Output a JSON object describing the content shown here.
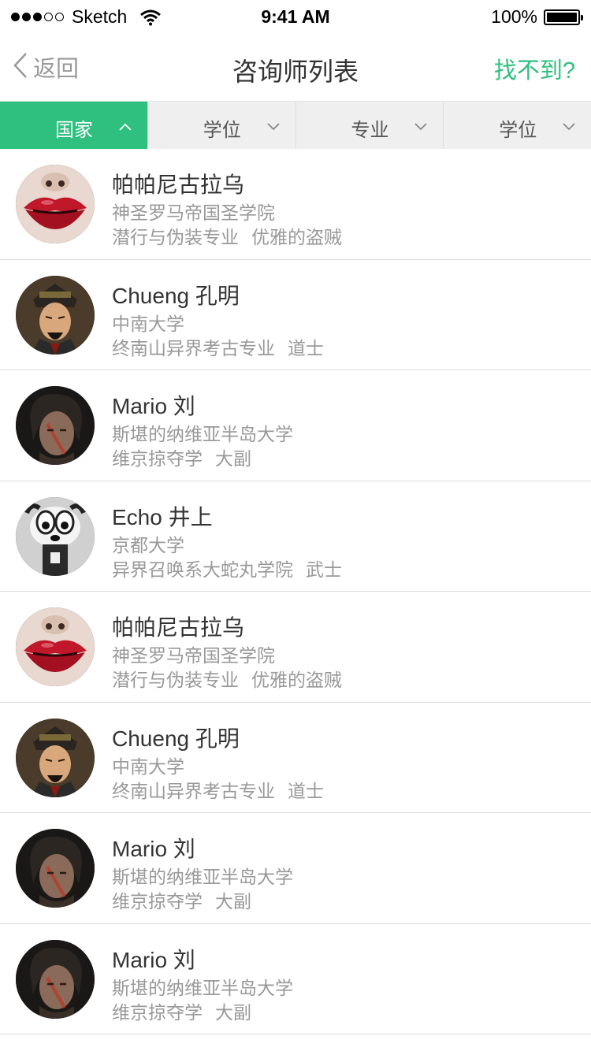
{
  "status_bar": {
    "carrier": "Sketch",
    "time": "9:41 AM",
    "battery": "100%"
  },
  "nav": {
    "back_label": "返回",
    "title": "咨询师列表",
    "action_label": "找不到?"
  },
  "filters": [
    {
      "label": "国家",
      "active": true
    },
    {
      "label": "学位",
      "active": false
    },
    {
      "label": "专业",
      "active": false
    },
    {
      "label": "学位",
      "active": false
    }
  ],
  "advisors": [
    {
      "name": "帕帕尼古拉乌",
      "school": "神圣罗马帝国圣学院",
      "major": "潜行与伪装专业",
      "degree": "优雅的盗贼",
      "avatar": "lips"
    },
    {
      "name": "Chueng 孔明",
      "school": "中南大学",
      "major": "终南山异界考古专业",
      "degree": "道士",
      "avatar": "kongming"
    },
    {
      "name": "Mario 刘",
      "school": "斯堪的纳维亚半岛大学",
      "major": "维京掠夺学",
      "degree": "大副",
      "avatar": "warrior"
    },
    {
      "name": "Echo 井上",
      "school": "京都大学",
      "major": "异界召唤系大蛇丸学院",
      "degree": "武士",
      "avatar": "cat"
    },
    {
      "name": "帕帕尼古拉乌",
      "school": "神圣罗马帝国圣学院",
      "major": "潜行与伪装专业",
      "degree": "优雅的盗贼",
      "avatar": "lips"
    },
    {
      "name": "Chueng 孔明",
      "school": "中南大学",
      "major": "终南山异界考古专业",
      "degree": "道士",
      "avatar": "kongming"
    },
    {
      "name": "Mario 刘",
      "school": "斯堪的纳维亚半岛大学",
      "major": "维京掠夺学",
      "degree": "大副",
      "avatar": "warrior"
    },
    {
      "name": "Mario 刘",
      "school": "斯堪的纳维亚半岛大学",
      "major": "维京掠夺学",
      "degree": "大副",
      "avatar": "warrior"
    }
  ],
  "colors": {
    "accent": "#2fbf7f",
    "filter_bg": "#efefef",
    "muted_text": "#999999"
  }
}
